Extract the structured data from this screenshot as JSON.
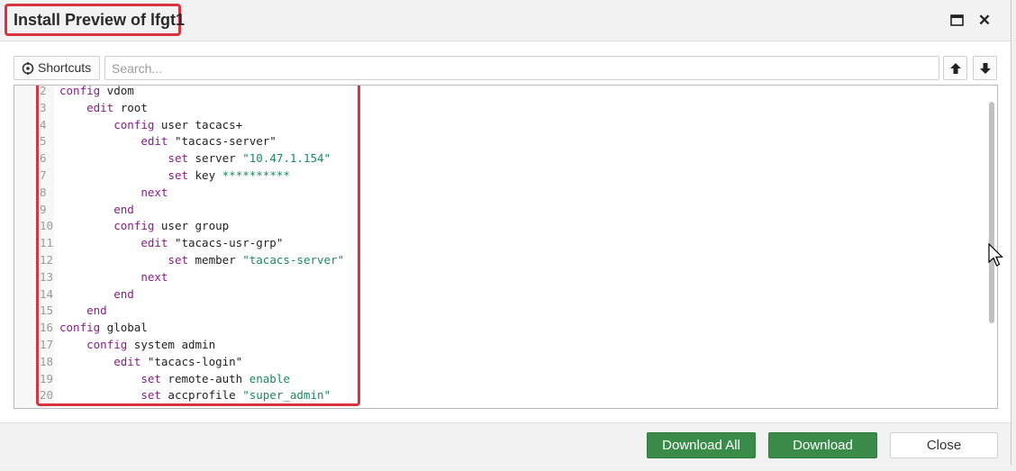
{
  "dialog": {
    "title": "Install Preview of lfgt1"
  },
  "toolbar": {
    "shortcuts_label": "Shortcuts",
    "search_placeholder": "Search...",
    "search_value": "",
    "icons": {
      "shortcuts": "shortcuts-icon",
      "up": "arrow-up-icon",
      "down": "arrow-down-icon",
      "maximize": "maximize-icon",
      "close": "close-icon"
    }
  },
  "editor": {
    "lines": [
      {
        "num": "2",
        "indent": "",
        "parts": [
          {
            "t": "config",
            "c": "kw"
          },
          {
            "t": " vdom",
            "c": ""
          }
        ]
      },
      {
        "num": "3",
        "indent": "    ",
        "parts": [
          {
            "t": "edit",
            "c": "kw"
          },
          {
            "t": " root",
            "c": ""
          }
        ]
      },
      {
        "num": "4",
        "indent": "        ",
        "parts": [
          {
            "t": "config",
            "c": "kw"
          },
          {
            "t": " user tacacs+",
            "c": ""
          }
        ]
      },
      {
        "num": "5",
        "indent": "            ",
        "parts": [
          {
            "t": "edit",
            "c": "kw"
          },
          {
            "t": " \"tacacs-server\"",
            "c": ""
          }
        ]
      },
      {
        "num": "6",
        "indent": "                ",
        "parts": [
          {
            "t": "set",
            "c": "kw"
          },
          {
            "t": " server ",
            "c": ""
          },
          {
            "t": "\"10.47.1.154\"",
            "c": "str"
          }
        ]
      },
      {
        "num": "7",
        "indent": "                ",
        "parts": [
          {
            "t": "set",
            "c": "kw"
          },
          {
            "t": " key ",
            "c": ""
          },
          {
            "t": "**********",
            "c": "str"
          }
        ]
      },
      {
        "num": "8",
        "indent": "            ",
        "parts": [
          {
            "t": "next",
            "c": "kw"
          }
        ]
      },
      {
        "num": "9",
        "indent": "        ",
        "parts": [
          {
            "t": "end",
            "c": "kw"
          }
        ]
      },
      {
        "num": "10",
        "indent": "        ",
        "parts": [
          {
            "t": "config",
            "c": "kw"
          },
          {
            "t": " user group",
            "c": ""
          }
        ]
      },
      {
        "num": "11",
        "indent": "            ",
        "parts": [
          {
            "t": "edit",
            "c": "kw"
          },
          {
            "t": " \"tacacs-usr-grp\"",
            "c": ""
          }
        ]
      },
      {
        "num": "12",
        "indent": "                ",
        "parts": [
          {
            "t": "set",
            "c": "kw"
          },
          {
            "t": " member ",
            "c": ""
          },
          {
            "t": "\"tacacs-server\"",
            "c": "str"
          }
        ]
      },
      {
        "num": "13",
        "indent": "            ",
        "parts": [
          {
            "t": "next",
            "c": "kw"
          }
        ]
      },
      {
        "num": "14",
        "indent": "        ",
        "parts": [
          {
            "t": "end",
            "c": "kw"
          }
        ]
      },
      {
        "num": "15",
        "indent": "    ",
        "parts": [
          {
            "t": "end",
            "c": "kw"
          }
        ]
      },
      {
        "num": "16",
        "indent": "",
        "parts": [
          {
            "t": "config",
            "c": "kw"
          },
          {
            "t": " global",
            "c": ""
          }
        ]
      },
      {
        "num": "17",
        "indent": "    ",
        "parts": [
          {
            "t": "config",
            "c": "kw"
          },
          {
            "t": " system admin",
            "c": ""
          }
        ]
      },
      {
        "num": "18",
        "indent": "        ",
        "parts": [
          {
            "t": "edit",
            "c": "kw"
          },
          {
            "t": " \"tacacs-login\"",
            "c": ""
          }
        ]
      },
      {
        "num": "19",
        "indent": "            ",
        "parts": [
          {
            "t": "set",
            "c": "kw"
          },
          {
            "t": " remote-auth ",
            "c": ""
          },
          {
            "t": "enable",
            "c": "str"
          }
        ]
      },
      {
        "num": "20",
        "indent": "            ",
        "parts": [
          {
            "t": "set",
            "c": "kw"
          },
          {
            "t": " accprofile ",
            "c": ""
          },
          {
            "t": "\"super_admin\"",
            "c": "str"
          }
        ]
      }
    ]
  },
  "footer": {
    "download_all_label": "Download All",
    "download_label": "Download",
    "close_label": "Close"
  },
  "colors": {
    "highlight_border": "#d9333f",
    "primary_button": "#3a8a4a",
    "keyword": "#8a1b8a",
    "string": "#1a8a5a"
  }
}
